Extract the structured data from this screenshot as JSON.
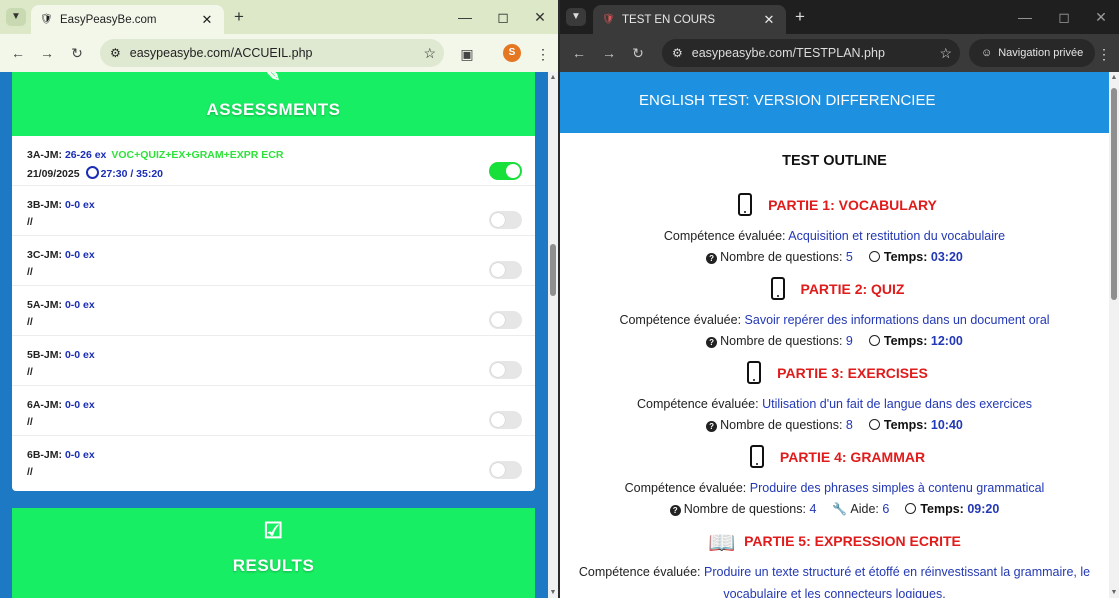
{
  "left": {
    "tab_title": "EasyPeasyBe.com",
    "url": "easypeasybe.com/ACCUEIL.php",
    "avatar_letter": "S",
    "assessments_title": "ASSESSMENTS",
    "results_title": "RESULTS",
    "rows": [
      {
        "cls": "3A-JM:",
        "count": "26-26 ex",
        "desc": "VOC+QUIZ+EX+GRAM+EXPR ECR",
        "date": "21/09/2025",
        "time": "27:30 / 35:20",
        "toggle_on": true
      },
      {
        "cls": "3B-JM:",
        "count": "0-0 ex",
        "desc": "",
        "date": "//",
        "time": "",
        "toggle_on": false
      },
      {
        "cls": "3C-JM:",
        "count": "0-0 ex",
        "desc": "",
        "date": "//",
        "time": "",
        "toggle_on": false
      },
      {
        "cls": "5A-JM:",
        "count": "0-0 ex",
        "desc": "",
        "date": "//",
        "time": "",
        "toggle_on": false
      },
      {
        "cls": "5B-JM:",
        "count": "0-0 ex",
        "desc": "",
        "date": "//",
        "time": "",
        "toggle_on": false
      },
      {
        "cls": "6A-JM:",
        "count": "0-0 ex",
        "desc": "",
        "date": "//",
        "time": "",
        "toggle_on": false
      },
      {
        "cls": "6B-JM:",
        "count": "0-0 ex",
        "desc": "",
        "date": "//",
        "time": "",
        "toggle_on": false
      }
    ]
  },
  "right": {
    "tab_title": "TEST EN COURS",
    "url": "easypeasybe.com/TESTPLAN.php",
    "incognito_label": "Navigation privée",
    "header": "ENGLISH TEST: VERSION DIFFERENCIEE",
    "outline_title": "TEST OUTLINE",
    "comp_label": "Compétence évaluée:",
    "questions_label": "Nombre de questions:",
    "time_label": "Temps:",
    "aide_label": "Aide:",
    "sections": [
      {
        "title": "PARTIE 1: VOCABULARY",
        "comp": "Acquisition et restitution du vocabulaire",
        "questions": "5",
        "time": "03:20"
      },
      {
        "title": "PARTIE 2: QUIZ",
        "comp": "Savoir repérer des informations dans un document oral",
        "questions": "9",
        "time": "12:00"
      },
      {
        "title": "PARTIE 3: EXERCISES",
        "comp": "Utilisation d'un fait de langue dans des exercices",
        "questions": "8",
        "time": "10:40"
      },
      {
        "title": "PARTIE 4: GRAMMAR",
        "comp": "Produire des phrases simples à contenu grammatical",
        "questions": "4",
        "aide": "6",
        "time": "09:20"
      },
      {
        "title": "PARTIE 5: EXPRESSION ECRITE",
        "comp": "Produire un texte structuré et étoffé en réinvestissant la grammaire, le vocabulaire et les connecteurs logiques."
      }
    ]
  },
  "colors": {
    "green": "#18ee63",
    "blue_bg": "#1d79c4",
    "header_blue": "#1e90e0",
    "red": "#e01b1b",
    "link_blue": "#2338b4"
  }
}
